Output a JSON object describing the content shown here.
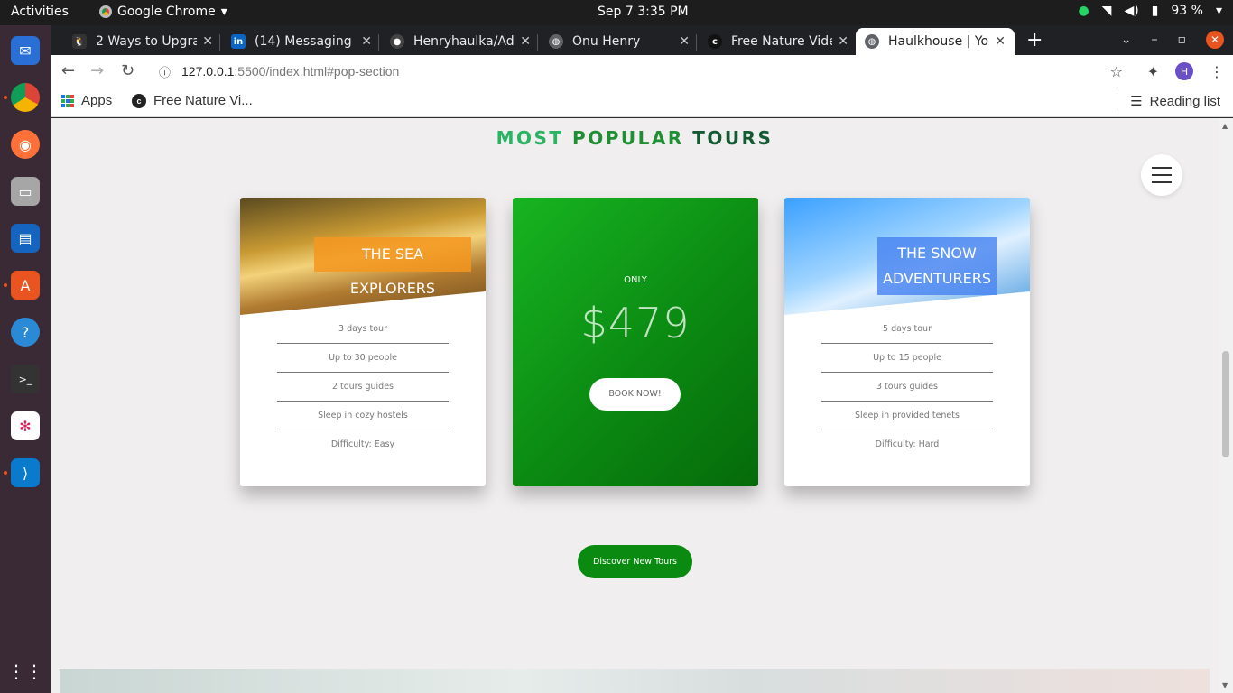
{
  "system": {
    "activities": "Activities",
    "app_name": "Google Chrome",
    "clock": "Sep 7   3:35 PM",
    "battery": "93 %"
  },
  "tabs": [
    {
      "title": "2 Ways to Upgrade",
      "icon": "linux-icon",
      "color": "#333333"
    },
    {
      "title": "(14) Messaging |",
      "icon": "linkedin-icon",
      "color": "#0a66c2"
    },
    {
      "title": "Henryhaulka/Ad",
      "icon": "github-icon",
      "color": "#444444"
    },
    {
      "title": "Onu Henry",
      "icon": "globe-icon",
      "color": "#5f6368"
    },
    {
      "title": "Free Nature Vide",
      "icon": "coverr-icon",
      "color": "#111111"
    },
    {
      "title": "Haulkhouse | You",
      "icon": "globe-icon",
      "color": "#5f6368"
    }
  ],
  "address": {
    "host": "127.0.0.1",
    "path": ":5500/index.html#pop-section"
  },
  "bookmarks": {
    "apps": "Apps",
    "item": "Free Nature Vi...",
    "reading_list": "Reading list"
  },
  "profile_initial": "H",
  "section": {
    "heading_1": "MOST",
    "heading_2": "POPULAR",
    "heading_3": "TOURS"
  },
  "cards": [
    {
      "title": "THE SEA EXPLORERS",
      "features": [
        "3 days tour",
        "Up to 30 people",
        "2 tours guides",
        "Sleep in cozy hostels",
        "Difficulty: Easy"
      ]
    },
    {
      "only": "ONLY",
      "price": "$479",
      "button": "BOOK NOW!"
    },
    {
      "title": "THE SNOW ADVENTURERS",
      "features": [
        "5 days tour",
        "Up to 15 people",
        "3 tours guides",
        "Sleep in provided tenets",
        "Difficulty: Hard"
      ]
    }
  ],
  "discover_button": "Discover New Tours",
  "colors": {
    "green_accent": "#0b8a12",
    "heading_light": "#28b463",
    "heading_dark": "#145a32",
    "ubuntu_orange": "#e95420"
  }
}
